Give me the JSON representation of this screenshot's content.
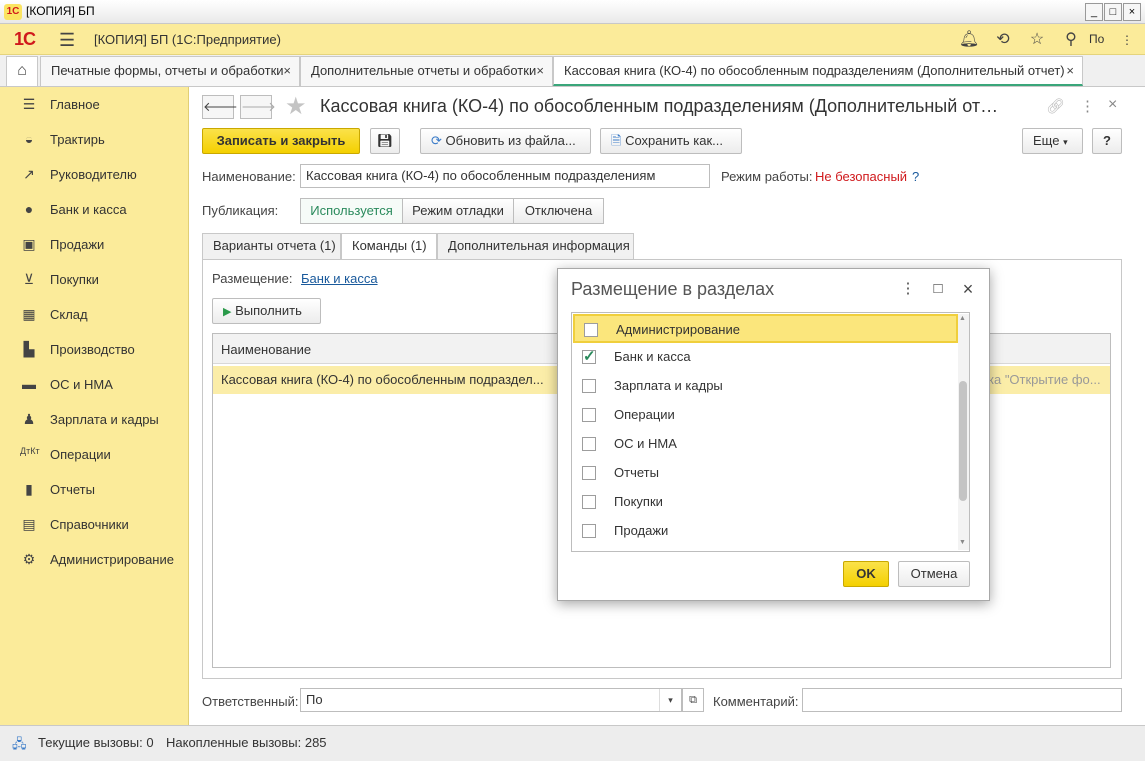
{
  "window": {
    "title": "[КОПИЯ] БП",
    "logo": "1C"
  },
  "app": {
    "logo": "1С",
    "title": "[КОПИЯ] БП  (1С:Предприятие)",
    "user_short": "По",
    "icons": [
      "bell-icon",
      "history-icon",
      "star-icon",
      "search-icon",
      "user-icon",
      "menu-icon"
    ]
  },
  "tabs": [
    {
      "label": "Печатные формы, отчеты и обработки"
    },
    {
      "label": "Дополнительные отчеты и обработки"
    },
    {
      "label": "Кассовая книга (КО-4) по обособленным подразделениям (Дополнительный отчет)"
    }
  ],
  "sidebar": {
    "items": [
      {
        "label": "Главное"
      },
      {
        "label": "Трактирь"
      },
      {
        "label": "Руководителю"
      },
      {
        "label": "Банк и касса"
      },
      {
        "label": "Продажи"
      },
      {
        "label": "Покупки"
      },
      {
        "label": "Склад"
      },
      {
        "label": "Производство"
      },
      {
        "label": "ОС и НМА"
      },
      {
        "label": "Зарплата и кадры"
      },
      {
        "label": "Операции"
      },
      {
        "label": "Отчеты"
      },
      {
        "label": "Справочники"
      },
      {
        "label": "Администрирование"
      }
    ]
  },
  "form": {
    "title": "Кассовая книга (КО-4) по обособленным подразделениям (Дополнительный от…",
    "toolbar": {
      "save_close": "Записать и закрыть",
      "refresh_from_file": "Обновить из файла...",
      "save_as": "Сохранить как...",
      "more": "Еще",
      "help": "?"
    },
    "name_label": "Наименование:",
    "name_value": "Кассовая книга (КО-4) по обособленным подразделениям",
    "mode_label": "Режим работы:",
    "mode_value": "Не безопасный",
    "mode_help": "?",
    "publication_label": "Публикация:",
    "publication_options": [
      "Используется",
      "Режим отладки",
      "Отключена"
    ],
    "inner_tabs": [
      "Варианты отчета (1)",
      "Команды (1)",
      "Дополнительная информация"
    ],
    "placement_label": "Размещение:",
    "placement_value": "Банк и касса",
    "run_button": "Выполнить",
    "grid": {
      "header_name": "Наименование",
      "rows": [
        {
          "name": "Кассовая книга (КО-4) по обособленным подраздел...",
          "right": "ка \"Открытие фо..."
        }
      ]
    },
    "responsible_label": "Ответственный:",
    "responsible_value": "По",
    "comment_label": "Комментарий:",
    "comment_value": ""
  },
  "status": {
    "current_calls": "Текущие вызовы: 0",
    "accumulated_calls": "Накопленные вызовы: 285"
  },
  "dialog": {
    "title": "Размещение в разделах",
    "items": [
      {
        "label": "Администрирование",
        "checked": false,
        "selected": true
      },
      {
        "label": "Банк и касса",
        "checked": true,
        "selected": false
      },
      {
        "label": "Зарплата и кадры",
        "checked": false,
        "selected": false
      },
      {
        "label": "Операции",
        "checked": false,
        "selected": false
      },
      {
        "label": "ОС и НМА",
        "checked": false,
        "selected": false
      },
      {
        "label": "Отчеты",
        "checked": false,
        "selected": false
      },
      {
        "label": "Покупки",
        "checked": false,
        "selected": false
      },
      {
        "label": "Продажи",
        "checked": false,
        "selected": false
      }
    ],
    "ok": "OK",
    "cancel": "Отмена"
  },
  "colors": {
    "accent_yellow": "#fbeb9a",
    "primary_button": "#f4d000",
    "active_green": "#2a8a5c",
    "danger_red": "#d0191c",
    "link_blue": "#1a5a9c"
  }
}
